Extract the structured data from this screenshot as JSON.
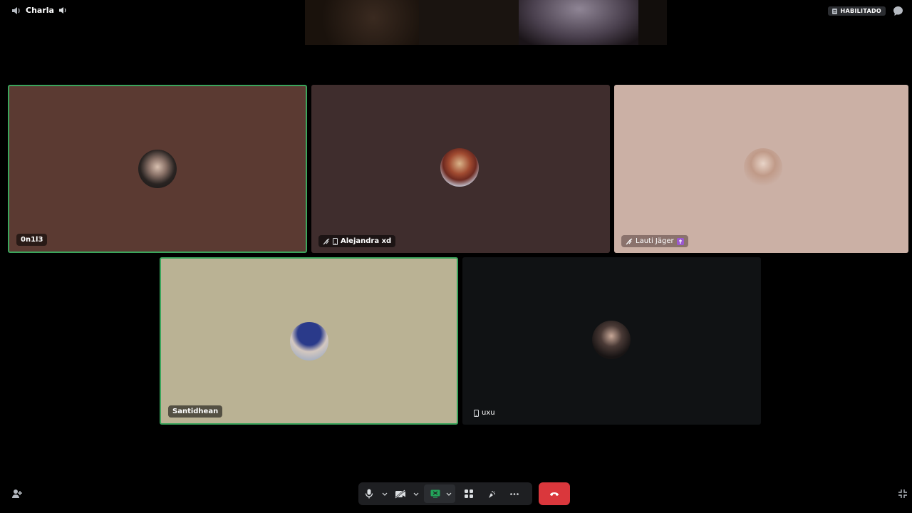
{
  "channel": {
    "name": "Charla"
  },
  "status_badge": {
    "label": "HABILITADO"
  },
  "participants": [
    {
      "name": "0n1l3",
      "speaking": true,
      "bg": "#5b3a32"
    },
    {
      "name": "Alejandra xd",
      "speaking": false,
      "bg": "#3f2d2d",
      "video_off": true,
      "mobile": true
    },
    {
      "name": "Lauti Jäger",
      "speaking": false,
      "bg": "#cbb0a5",
      "video_off": true
    },
    {
      "name": "Santidhean",
      "speaking": true,
      "bg": "#bab294"
    },
    {
      "name": "uxu",
      "speaking": false,
      "bg": "#101214",
      "mobile": true
    }
  ],
  "colors": {
    "speaking_border": "#3ba55c",
    "hangup": "#da373c",
    "control_bg": "#1e1f22"
  },
  "icons": {
    "channel": "speaker-icon",
    "volume": "volume-icon",
    "chat": "chat-bubble-icon",
    "mic": "microphone-icon",
    "camera": "camera-off-icon",
    "share": "screen-share-icon",
    "activities": "activities-icon",
    "soundboard": "soundboard-icon",
    "more": "more-icon",
    "hangup": "phone-hangup-icon",
    "invite": "add-person-icon",
    "minimize": "minimize-icon"
  }
}
